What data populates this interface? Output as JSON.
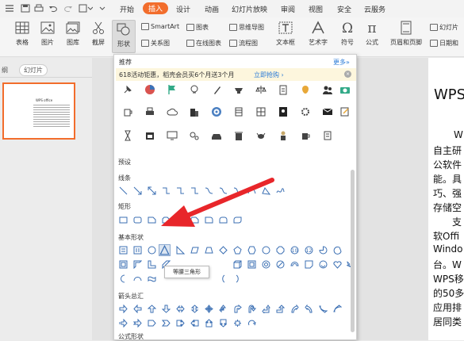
{
  "menubar": {
    "tabs": [
      {
        "label": "开始",
        "active": false
      },
      {
        "label": "插入",
        "active": true
      },
      {
        "label": "设计",
        "active": false
      },
      {
        "label": "动画",
        "active": false
      },
      {
        "label": "幻灯片放映",
        "active": false
      },
      {
        "label": "审阅",
        "active": false
      },
      {
        "label": "视图",
        "active": false
      },
      {
        "label": "安全",
        "active": false
      },
      {
        "label": "云服务",
        "active": false
      }
    ],
    "accent_color": "#f26d2c"
  },
  "ribbon": {
    "table": "表格",
    "picture": "图片",
    "gallery": "图库",
    "screenshot": "截屏",
    "shapes": "形状",
    "smartart": "SmartArt",
    "chart": "图表",
    "mindmap": "思维导图",
    "relation": "关系图",
    "online_chart": "在线图表",
    "flowchart": "流程图",
    "textbox": "文本框",
    "wordart": "艺术字",
    "symbol": "符号",
    "formula": "公式",
    "header_footer": "页眉和页脚",
    "slide_num": "幻灯片",
    "datetime": "日期和"
  },
  "left_panel": {
    "outline_tab": "纲",
    "slides_tab": "幻灯片",
    "thumb_title": "WPS office"
  },
  "slide": {
    "title": "WPS",
    "lines": [
      "W",
      "自主研",
      "公软件",
      "能。具",
      "巧、强",
      "存储空",
      "支",
      "软Offi",
      "Windo",
      "台。W",
      "WPS移",
      "的50多",
      "应用排",
      "居同类"
    ]
  },
  "dropdown": {
    "recommend": "推荐",
    "more": "更多»",
    "banner_text": "618活动钜惠，稻壳会员买6个月送3个月",
    "banner_link": "立即抢购 ›",
    "preset": "预设",
    "sections": [
      "线条",
      "矩形",
      "基本形状",
      "箭头总汇",
      "公式形状"
    ],
    "tooltip": "等腰三角形"
  }
}
